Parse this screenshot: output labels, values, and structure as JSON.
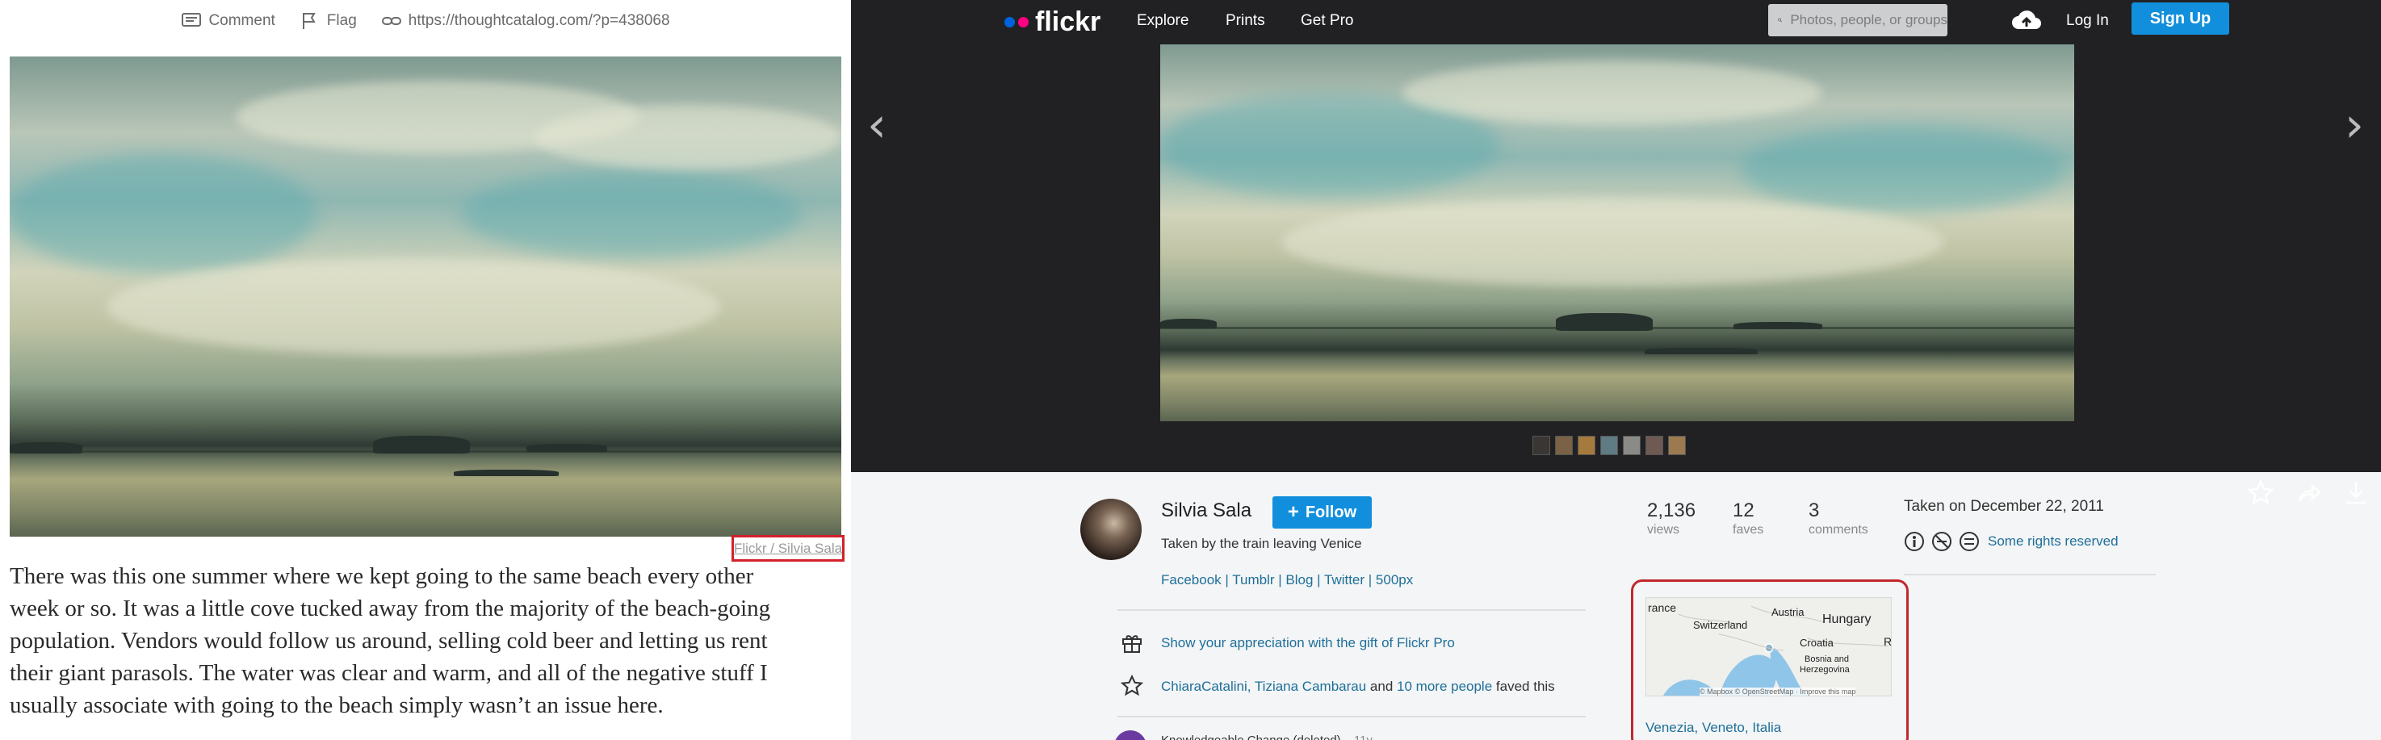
{
  "left": {
    "toolbar": {
      "comment_label": "Comment",
      "flag_label": "Flag",
      "link_label": "https://thoughtcatalog.com/?p=438068"
    },
    "photo_credit": "Flickr / Silvia Sala",
    "body_lines": [
      "There was this one summer where we kept going to the same beach every other",
      "week or so. It was a little cove tucked away from the majority of the beach-going",
      "population. Vendors would follow us around, selling cold beer and letting us rent",
      "their giant parasols. The water was clear and warm, and all of the negative stuff I",
      "usually associate with going to the beach simply wasn’t an issue here."
    ]
  },
  "flickr": {
    "logo_text": "flickr",
    "nav": {
      "explore": "Explore",
      "prints": "Prints",
      "getpro": "Get Pro"
    },
    "search_placeholder": "Photos, people, or groups",
    "login": "Log In",
    "signup": "Sign Up",
    "author": {
      "name": "Silvia Sala",
      "follow": "Follow",
      "description": "Taken by the train leaving Venice",
      "links": [
        "Facebook",
        "Tumblr",
        "Blog",
        "Twitter",
        "500px"
      ]
    },
    "stats": [
      {
        "value": "2,136",
        "label": "views"
      },
      {
        "value": "12",
        "label": "faves"
      },
      {
        "value": "3",
        "label": "comments"
      }
    ],
    "taken_on": "Taken on December 22, 2011",
    "rights": "Some rights reserved",
    "gift_text": "Show your appreciation with the gift of Flickr Pro",
    "faved": {
      "names": "ChiaraCatalini, Tiziana Cambarau",
      "and": "and",
      "more": "10 more people",
      "suffix": "faved this"
    },
    "comment_preview": {
      "author": "Knowledgeable Change (deleted)",
      "age": "11y"
    },
    "map": {
      "labels": [
        "rance",
        "Switzerland",
        "Austria",
        "Hungary",
        "Croatia",
        "Bosnia and",
        "Herzegovina",
        "R"
      ],
      "attribution": "© Mapbox © OpenStreetMap · Improve this map",
      "location": "Venezia, Veneto, Italia"
    },
    "colors": {
      "accent": "#128fdc",
      "nav_bg": "#212124",
      "highlight": "#c1282f",
      "logo_blue": "#0063dc",
      "logo_pink": "#ff0084"
    }
  }
}
